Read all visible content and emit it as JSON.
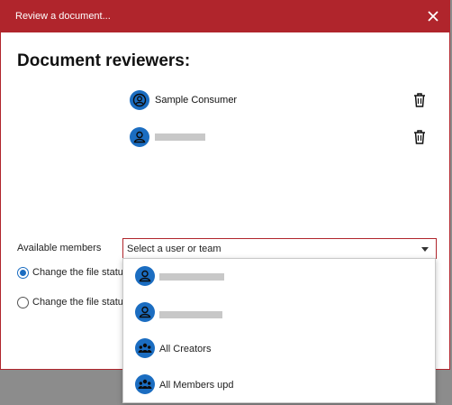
{
  "dialog": {
    "title": "Review a document...",
    "heading": "Document reviewers:"
  },
  "reviewers": [
    {
      "name": "Sample Consumer",
      "icon": "user-circle-icon",
      "redacted": false
    },
    {
      "name": "",
      "icon": "user-icon",
      "redacted": true
    }
  ],
  "members": {
    "label": "Available members",
    "placeholder": "Select a user or team"
  },
  "radios": [
    {
      "label": "Change the file status",
      "checked": true
    },
    {
      "label": "Change the file status",
      "checked": false
    }
  ],
  "dropdown": {
    "options": [
      {
        "label": "",
        "icon": "user-icon",
        "redacted": true
      },
      {
        "label": "",
        "icon": "user-icon",
        "redacted": true
      },
      {
        "label": "All Creators",
        "icon": "team-icon",
        "redacted": false
      },
      {
        "label": "All Members upd",
        "icon": "team-icon",
        "redacted": false
      }
    ]
  },
  "colors": {
    "accent": "#b0252c",
    "avatar": "#1b6dc1",
    "overlay": "#8c8c8c"
  }
}
